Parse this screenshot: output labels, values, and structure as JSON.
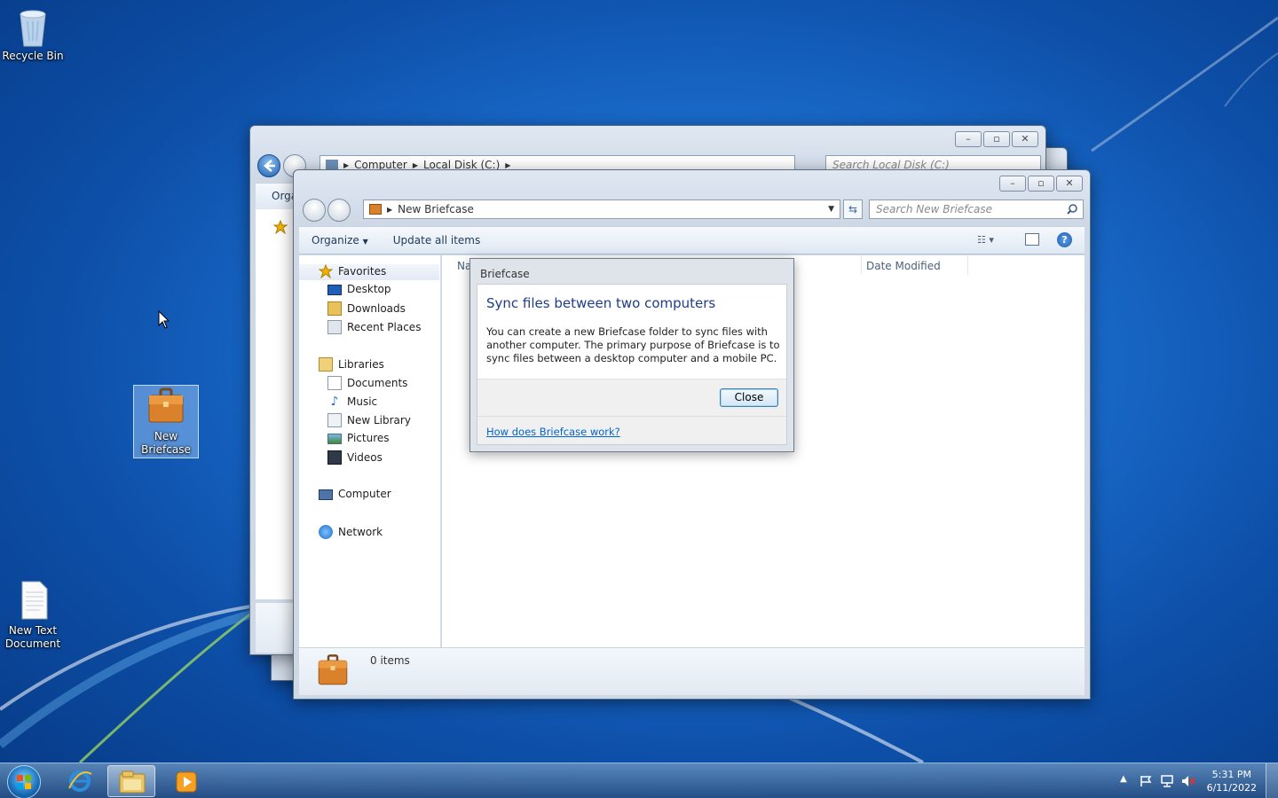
{
  "desktop": {
    "icons": [
      {
        "label": "Recycle Bin"
      },
      {
        "label": "New Briefcase"
      },
      {
        "label": "New Text Document"
      }
    ]
  },
  "back_window": {
    "breadcrumb": [
      "Computer",
      "Local Disk (C:)"
    ],
    "search_placeholder": "Search Local Disk (C:)",
    "organize_label": "Orga"
  },
  "front_window": {
    "breadcrumb": [
      "New Briefcase"
    ],
    "search_placeholder": "Search New Briefcase",
    "toolbar": {
      "organize": "Organize",
      "update_all": "Update all items"
    },
    "nav": {
      "favorites": "Favorites",
      "favorites_items": [
        "Desktop",
        "Downloads",
        "Recent Places"
      ],
      "libraries": "Libraries",
      "libraries_items": [
        "Documents",
        "Music",
        "New Library",
        "Pictures",
        "Videos"
      ],
      "computer": "Computer",
      "network": "Network"
    },
    "columns": {
      "name": "Na",
      "date_modified": "Date Modified"
    },
    "status": "0 items"
  },
  "dialog": {
    "title": "Briefcase",
    "heading": "Sync files between two computers",
    "body": "You can create a new Briefcase folder to sync files with another computer. The primary purpose of Briefcase is to sync files between a desktop computer and a mobile PC.",
    "close_button": "Close",
    "help_link": "How does Briefcase work?"
  },
  "taskbar": {
    "time": "5:31 PM",
    "date": "6/11/2022"
  }
}
